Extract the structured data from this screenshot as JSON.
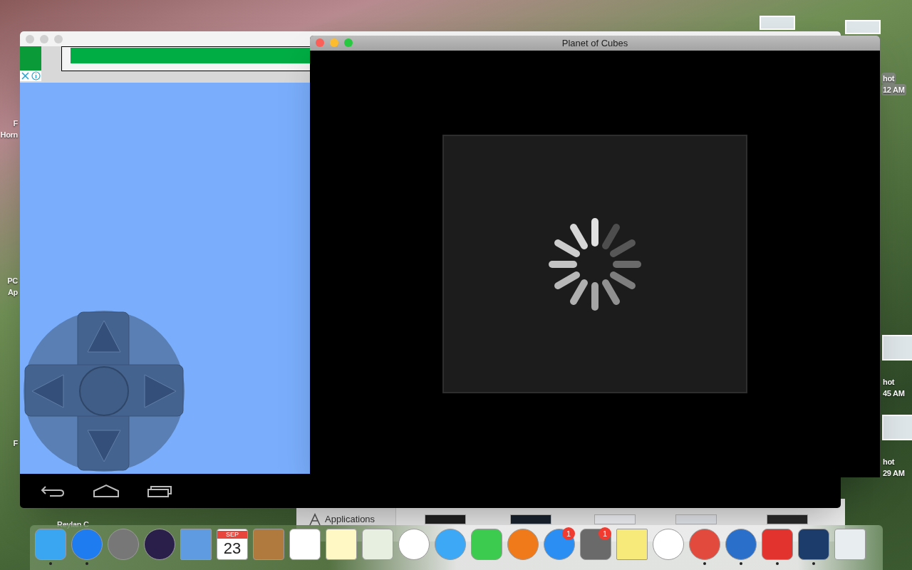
{
  "desktop_labels": [
    {
      "text": "F"
    },
    {
      "text": "Horn"
    },
    {
      "text": "PC"
    },
    {
      "text": "Ap"
    },
    {
      "text": "F"
    },
    {
      "text": "Reylan C"
    },
    {
      "text": "hot",
      "selected": true
    },
    {
      "text": "12 AM",
      "selected": true
    },
    {
      "text": "hot",
      "selected": false
    },
    {
      "text": "45 AM",
      "selected": false
    },
    {
      "text": "hot",
      "selected": false
    },
    {
      "text": "29 AM",
      "selected": false
    }
  ],
  "finder_window": {
    "sidebar_item": "Applications"
  },
  "game_window": {
    "title": "Planet of Cubes"
  },
  "dock": {
    "items": [
      {
        "kind": "finder",
        "running": true
      },
      {
        "kind": "safari",
        "running": true
      },
      {
        "kind": "launchpad",
        "running": false
      },
      {
        "kind": "siri",
        "running": false
      },
      {
        "kind": "mail",
        "running": false
      },
      {
        "kind": "calendar",
        "running": false,
        "month": "SEP",
        "day": "23"
      },
      {
        "kind": "contacts",
        "running": false
      },
      {
        "kind": "reminders",
        "running": false
      },
      {
        "kind": "notes",
        "running": false
      },
      {
        "kind": "maps",
        "running": false
      },
      {
        "kind": "photos",
        "running": false
      },
      {
        "kind": "messages",
        "running": false
      },
      {
        "kind": "facetime",
        "running": false
      },
      {
        "kind": "ibooks",
        "running": false
      },
      {
        "kind": "appstore",
        "running": false,
        "badge": "1"
      },
      {
        "kind": "preferences",
        "running": false,
        "badge": "1"
      },
      {
        "kind": "stickies",
        "running": false
      },
      {
        "kind": "itunes",
        "running": false
      },
      {
        "kind": "chrome",
        "running": true
      },
      {
        "kind": "robot",
        "running": true
      },
      {
        "kind": "bluestacks",
        "running": true
      },
      {
        "kind": "cubes",
        "running": true
      },
      {
        "kind": "trash",
        "running": false
      }
    ]
  }
}
